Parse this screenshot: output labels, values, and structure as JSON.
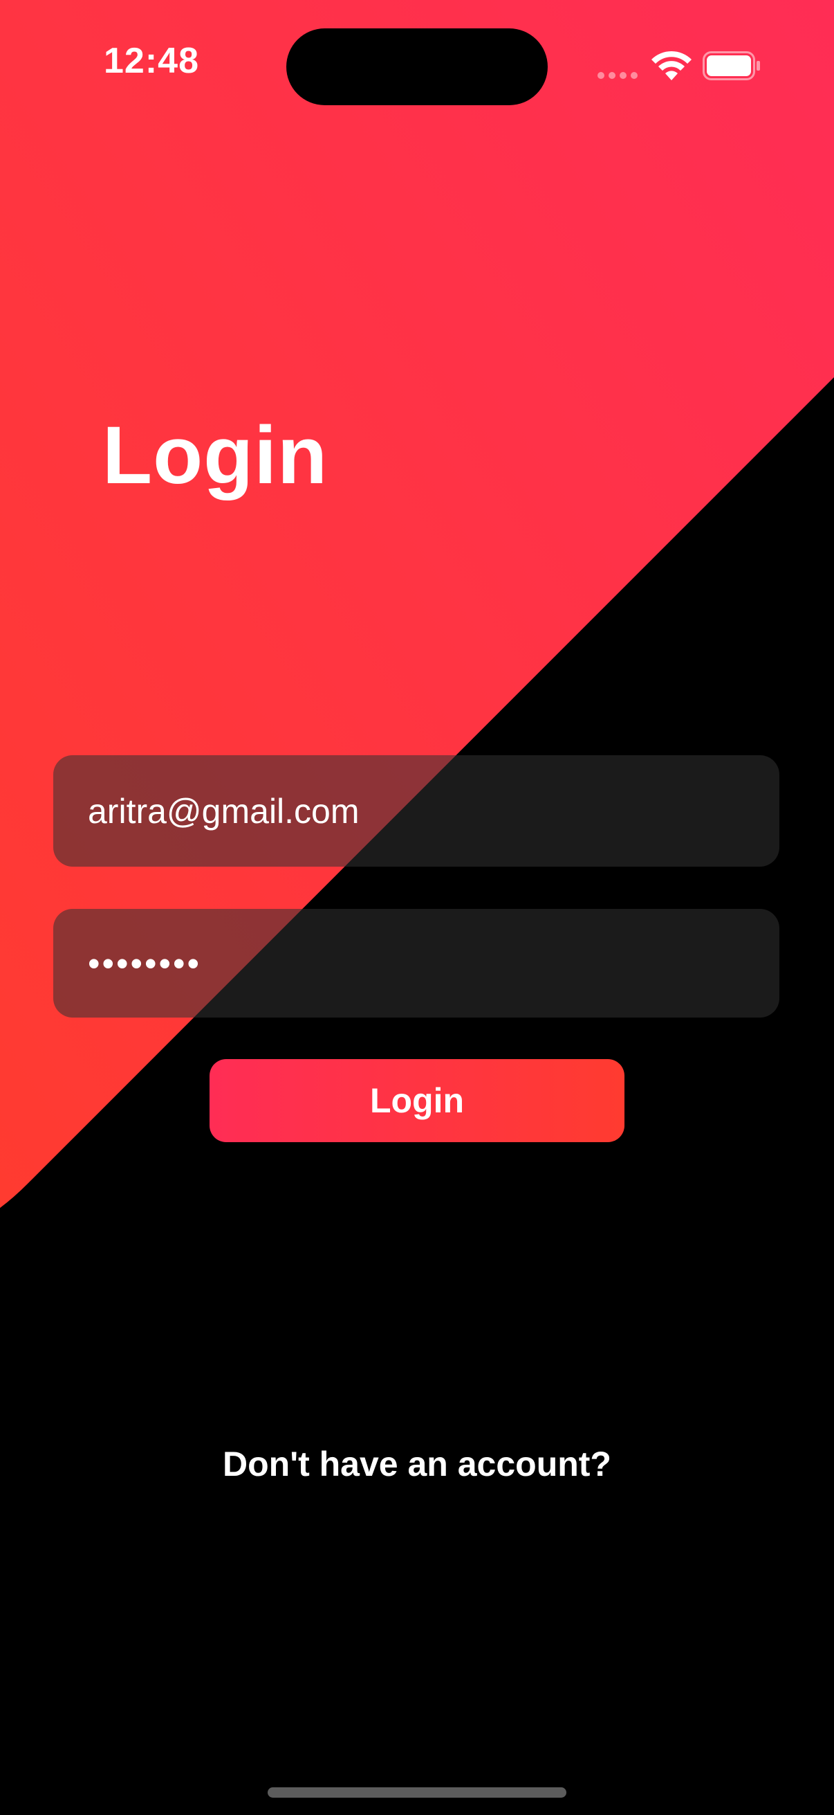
{
  "status_bar": {
    "time": "12:48"
  },
  "theme": {
    "accent_start": "#ff3b30",
    "accent_end": "#ff2d55",
    "background": "#000000"
  },
  "header": {
    "title": "Login"
  },
  "form": {
    "email_value": "aritra@gmail.com",
    "password_value": "••••••••",
    "login_label": "Login"
  },
  "footer": {
    "signup_text": "Don't have an account?"
  },
  "icons": {
    "wifi": "wifi-icon",
    "battery": "battery-icon"
  }
}
